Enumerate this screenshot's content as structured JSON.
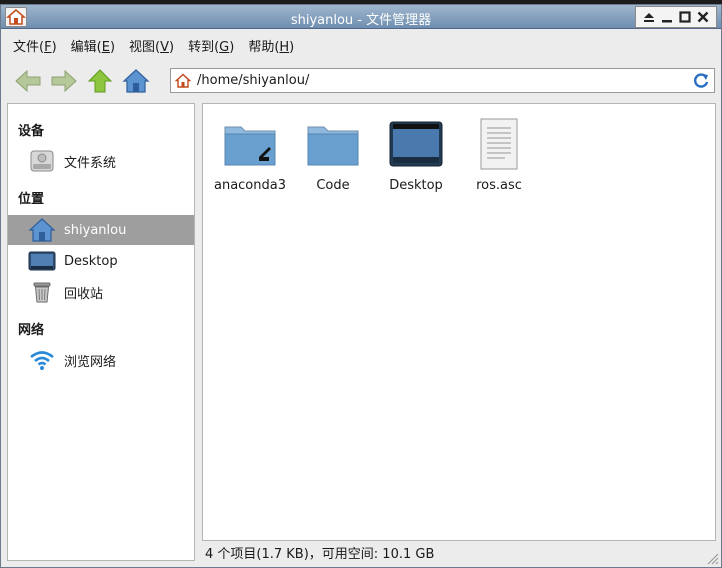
{
  "window": {
    "title": "shiyanlou - 文件管理器"
  },
  "menubar": {
    "items": [
      {
        "label": "文件(",
        "key": "F",
        "end": ")"
      },
      {
        "label": "编辑(",
        "key": "E",
        "end": ")"
      },
      {
        "label": "视图(",
        "key": "V",
        "end": ")"
      },
      {
        "label": "转到(",
        "key": "G",
        "end": ")"
      },
      {
        "label": "帮助(",
        "key": "H",
        "end": ")"
      }
    ]
  },
  "toolbar": {
    "location": "/home/shiyanlou/"
  },
  "sidebar": {
    "sections": [
      {
        "heading": "设备"
      },
      {
        "heading": "位置"
      },
      {
        "heading": "网络"
      }
    ],
    "items": [
      {
        "label": "文件系统",
        "icon": "drive-icon"
      },
      {
        "label": "shiyanlou",
        "icon": "home-folder-icon",
        "selected": true
      },
      {
        "label": "Desktop",
        "icon": "desktop-icon"
      },
      {
        "label": "回收站",
        "icon": "trash-icon"
      },
      {
        "label": "浏览网络",
        "icon": "wifi-icon"
      }
    ]
  },
  "files": [
    {
      "name": "anaconda3",
      "icon": "folder-link-icon"
    },
    {
      "name": "Code",
      "icon": "folder-icon"
    },
    {
      "name": "Desktop",
      "icon": "desktop-folder-icon"
    },
    {
      "name": "ros.asc",
      "icon": "text-file-icon"
    }
  ],
  "status": {
    "text": "4 个项目(1.7 KB)，可用空间: 10.1 GB"
  },
  "colors": {
    "titlebar": "#7f9cbd",
    "selection": "#9e9e9e",
    "folder": "#6aa0d0"
  }
}
